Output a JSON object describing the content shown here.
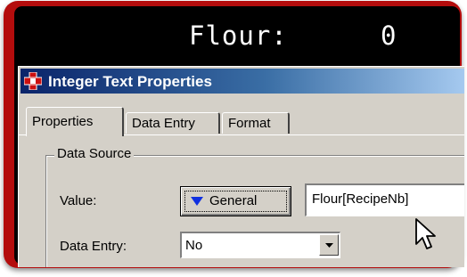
{
  "display": {
    "label": "Flour:",
    "value": "0"
  },
  "dialog": {
    "title": "Integer Text Properties",
    "tabs": [
      {
        "label": "Properties",
        "active": true
      },
      {
        "label": "Data Entry",
        "active": false
      },
      {
        "label": "Format",
        "active": false
      }
    ],
    "group": {
      "legend": "Data Source",
      "value_label": "Value:",
      "source_button_label": "General",
      "value_field": "Flour[RecipeNb]",
      "data_entry_label": "Data Entry:",
      "data_entry_selected": "No"
    }
  },
  "colors": {
    "frame": "#b40d0d",
    "titlebar_start": "#0a246a",
    "dialog_face": "#d4d0c8",
    "accent_triangle": "#1030e0"
  },
  "icons": {
    "app": "app-logo-icon",
    "source_button": "triangle-down-icon",
    "select_arrow": "chevron-down-icon",
    "pointer": "mouse-cursor-icon"
  }
}
